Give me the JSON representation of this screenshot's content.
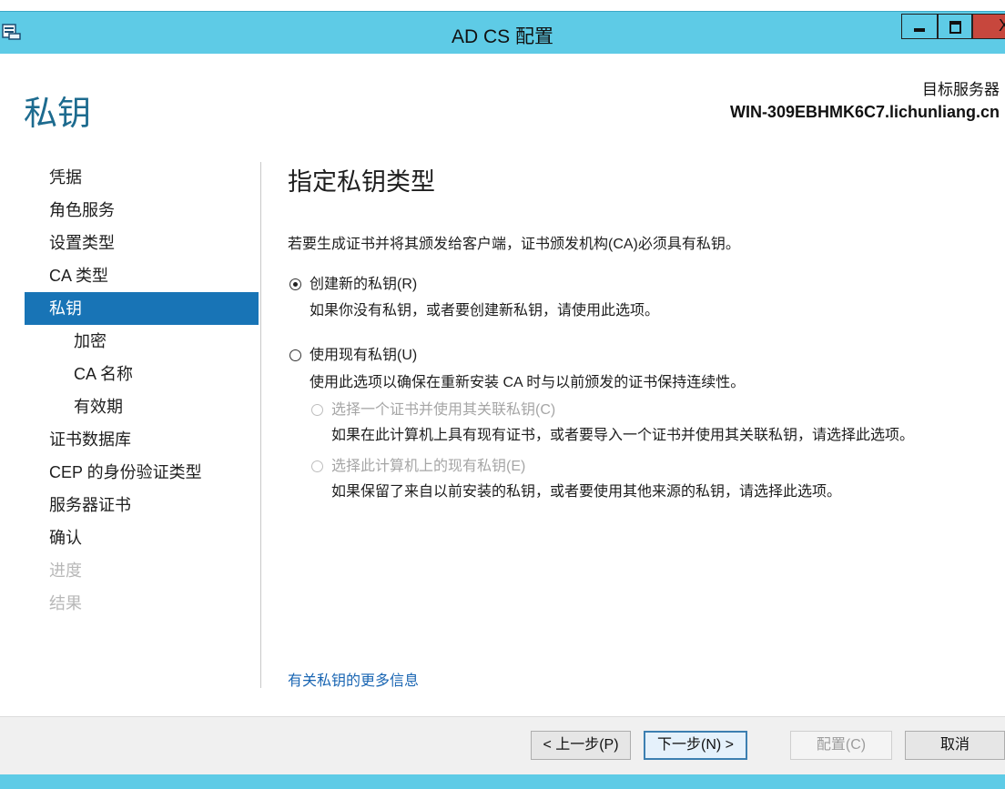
{
  "window": {
    "title": "AD CS 配置",
    "titlebar_color": "#5ecbe6",
    "close_symbol": "X"
  },
  "header": {
    "page_title": "私钥",
    "target_label": "目标服务器",
    "target_server": "WIN-309EBHMK6C7.lichunliang.cn"
  },
  "nav": {
    "items": [
      {
        "label": "凭据"
      },
      {
        "label": "角色服务"
      },
      {
        "label": "设置类型"
      },
      {
        "label": "CA 类型"
      },
      {
        "label": "私钥",
        "active": true
      },
      {
        "label": "加密",
        "sub": true
      },
      {
        "label": "CA 名称",
        "sub": true
      },
      {
        "label": "有效期",
        "sub": true
      },
      {
        "label": "证书数据库"
      },
      {
        "label": "CEP 的身份验证类型"
      },
      {
        "label": "服务器证书"
      },
      {
        "label": "确认"
      },
      {
        "label": "进度",
        "disabled": true
      },
      {
        "label": "结果",
        "disabled": true
      }
    ]
  },
  "main": {
    "heading": "指定私钥类型",
    "intro": "若要生成证书并将其颁发给客户端，证书颁发机构(CA)必须具有私钥。",
    "option_new": {
      "label": "创建新的私钥(R)",
      "desc": "如果你没有私钥，或者要创建新私钥，请使用此选项。",
      "checked": true
    },
    "option_existing": {
      "label": "使用现有私钥(U)",
      "desc": "使用此选项以确保在重新安装 CA 时与以前颁发的证书保持连续性。",
      "checked": false
    },
    "sub_option_cert": {
      "label": "选择一个证书并使用其关联私钥(C)",
      "desc": "如果在此计算机上具有现有证书，或者要导入一个证书并使用其关联私钥，请选择此选项。"
    },
    "sub_option_key": {
      "label": "选择此计算机上的现有私钥(E)",
      "desc": "如果保留了来自以前安装的私钥，或者要使用其他来源的私钥，请选择此选项。"
    },
    "more_info_link": "有关私钥的更多信息"
  },
  "footer": {
    "prev_label": "< 上一步(P)",
    "next_label": "下一步(N) >",
    "configure_label": "配置(C)",
    "cancel_label": "取消"
  },
  "colors": {
    "accent": "#1874b6",
    "title_text": "#1d6b8f",
    "link": "#1a66b3"
  }
}
